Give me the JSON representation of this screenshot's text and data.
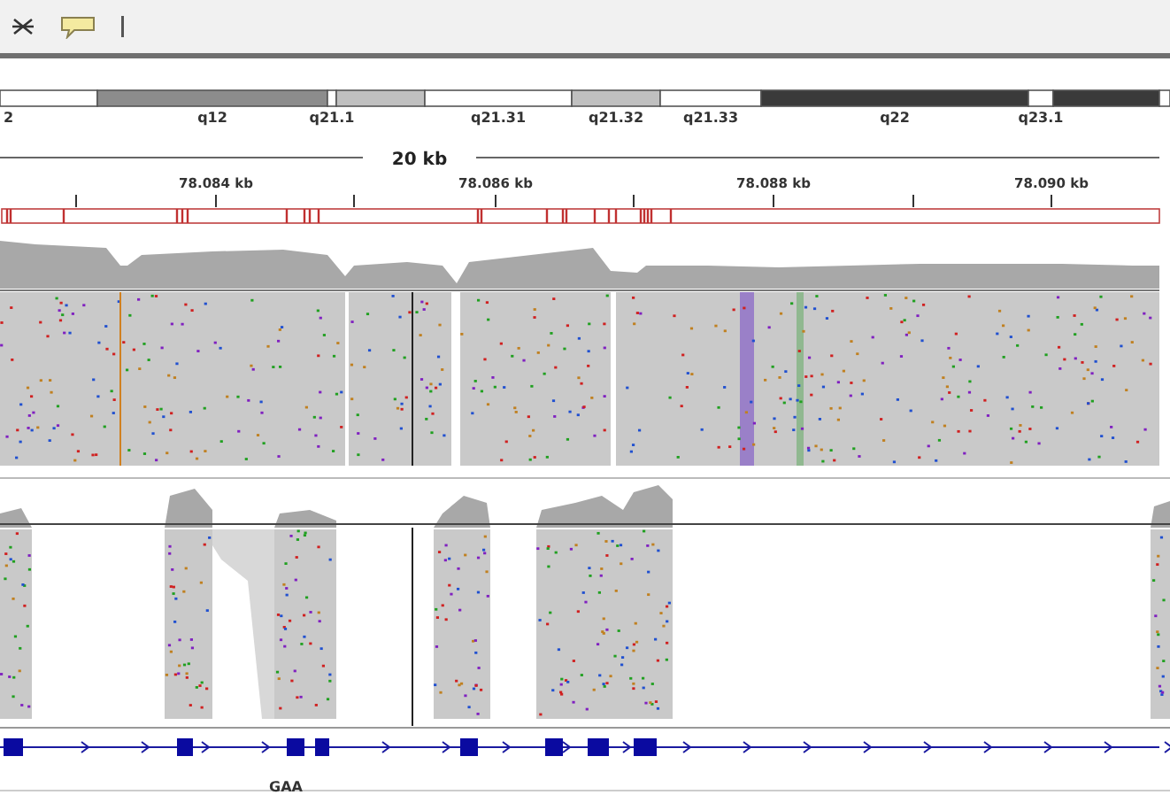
{
  "ideogram": {
    "bands": [
      {
        "label": "2",
        "color": "#ffffff"
      },
      {
        "label": "q12",
        "color": "#8c8c8c"
      },
      {
        "label": "q21.1",
        "color": "#ffffff"
      },
      {
        "color": "#c0c0c0"
      },
      {
        "label": "q21.31",
        "color": "#ffffff"
      },
      {
        "label": "q21.32",
        "color": "#c0c0c0"
      },
      {
        "label": "q21.33",
        "color": "#ffffff"
      },
      {
        "label": "q22",
        "color": "#3a3a3a"
      },
      {
        "label": "q23.1",
        "color": "#ffffff"
      },
      {
        "color": "#3a3a3a"
      },
      {
        "color": "#ffffff"
      }
    ]
  },
  "ruler": {
    "span": "20 kb",
    "ticks": [
      "78.084 kb",
      "78.086 kb",
      "78.088 kb",
      "78.090 kb"
    ]
  },
  "gene": {
    "name": "GAA"
  }
}
